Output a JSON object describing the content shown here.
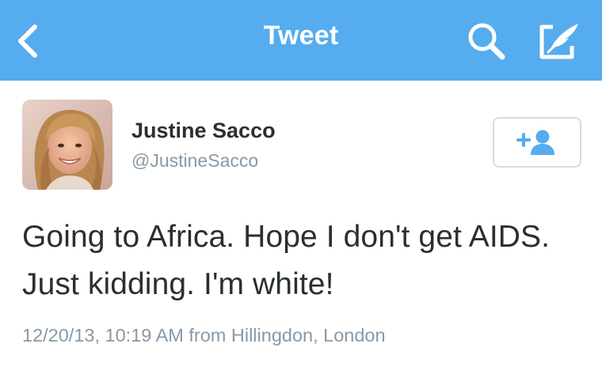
{
  "header": {
    "title": "Tweet",
    "back_icon": "chevron-left-icon",
    "search_icon": "search-icon",
    "compose_icon": "compose-quill-icon",
    "bar_color": "#55acee"
  },
  "tweet": {
    "author": {
      "name": "Justine Sacco",
      "handle": "@JustineSacco",
      "avatar_icon": "profile-photo"
    },
    "follow_icon": "add-user-icon",
    "text": "Going to Africa. Hope I don't get AIDS. Just kidding. I'm white!",
    "timestamp": "12/20/13, 10:19 AM",
    "from_label": "from",
    "location": "Hillingdon, London"
  },
  "colors": {
    "accent": "#55acee",
    "text_primary": "#292f33",
    "text_secondary": "#8899a6"
  }
}
